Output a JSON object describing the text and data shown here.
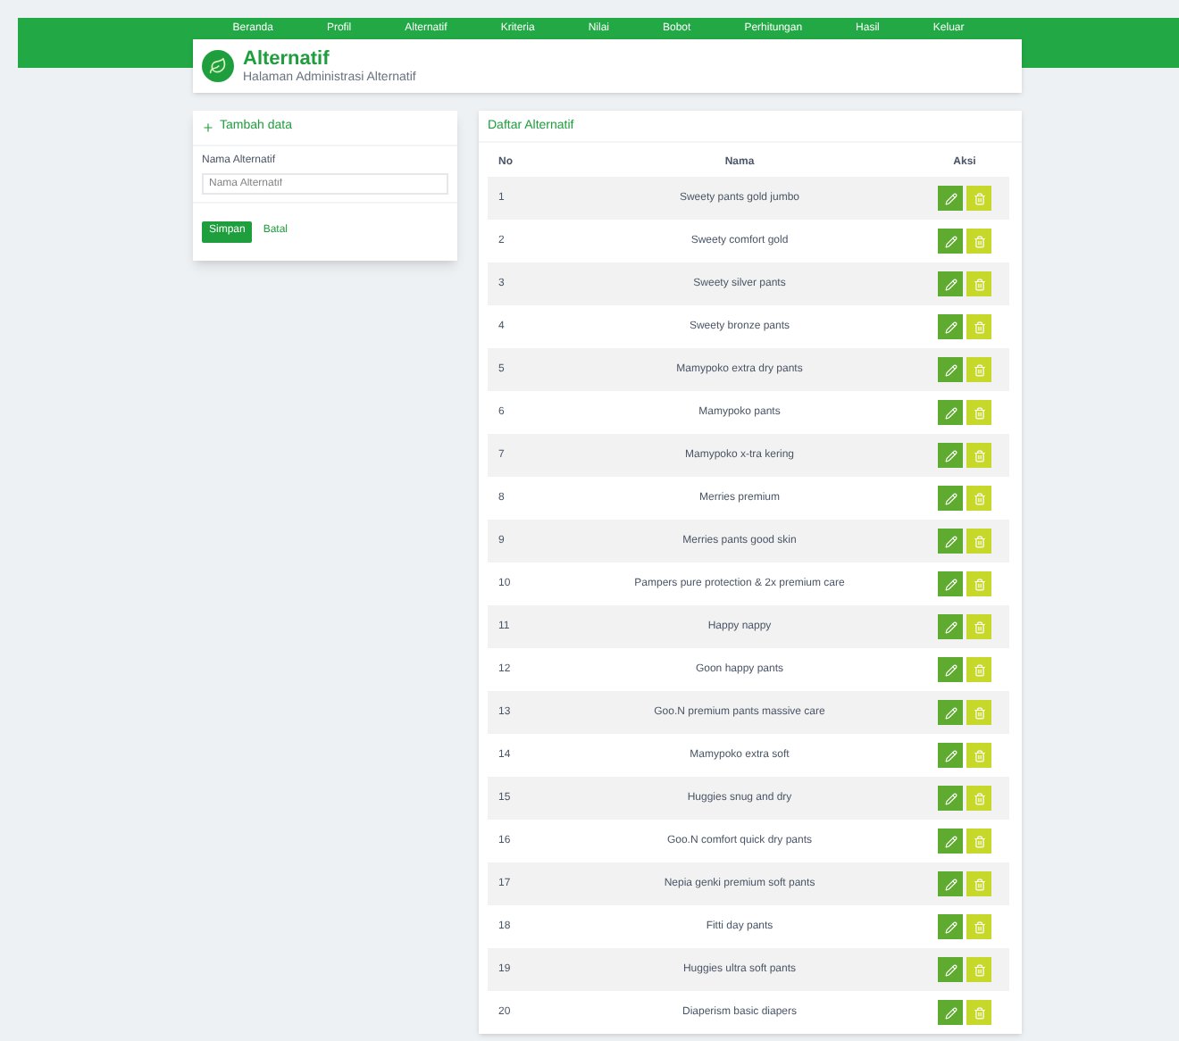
{
  "nav": [
    "Beranda",
    "Profil",
    "Alternatif",
    "Kriteria",
    "Nilai",
    "Bobot",
    "Perhitungan",
    "Hasil",
    "Keluar"
  ],
  "header": {
    "title": "Alternatif",
    "subtitle": "Halaman Administrasi Alternatif"
  },
  "form": {
    "title": "Tambah data",
    "label": "Nama Alternatif",
    "placeholder": "Nama Alternatif",
    "submit": "Simpan",
    "reset": "Batal"
  },
  "table": {
    "title": "Daftar Alternatif",
    "columns": [
      "No",
      "Nama",
      "Aksi"
    ],
    "rows": [
      {
        "no": "1",
        "name": "Sweety pants gold jumbo"
      },
      {
        "no": "2",
        "name": "Sweety comfort gold"
      },
      {
        "no": "3",
        "name": "Sweety silver pants"
      },
      {
        "no": "4",
        "name": "Sweety bronze pants"
      },
      {
        "no": "5",
        "name": "Mamypoko extra dry pants"
      },
      {
        "no": "6",
        "name": "Mamypoko pants"
      },
      {
        "no": "7",
        "name": "Mamypoko x-tra kering"
      },
      {
        "no": "8",
        "name": "Merries premium"
      },
      {
        "no": "9",
        "name": "Merries pants good skin"
      },
      {
        "no": "10",
        "name": "Pampers pure protection & 2x premium care"
      },
      {
        "no": "11",
        "name": "Happy nappy"
      },
      {
        "no": "12",
        "name": "Goon happy pants"
      },
      {
        "no": "13",
        "name": "Goo.N premium pants massive care"
      },
      {
        "no": "14",
        "name": "Mamypoko extra soft"
      },
      {
        "no": "15",
        "name": "Huggies snug and dry"
      },
      {
        "no": "16",
        "name": "Goo.N comfort quick dry pants"
      },
      {
        "no": "17",
        "name": "Nepia genki premium soft pants"
      },
      {
        "no": "18",
        "name": "Fitti day pants"
      },
      {
        "no": "19",
        "name": "Huggies ultra soft pants"
      },
      {
        "no": "20",
        "name": "Diaperism basic diapers"
      }
    ]
  }
}
